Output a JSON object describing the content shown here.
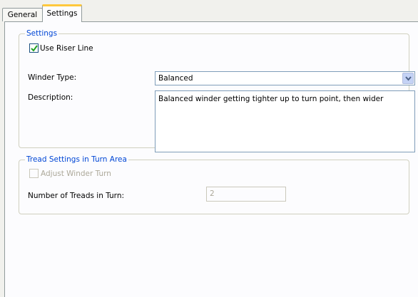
{
  "tabs": [
    {
      "label": "General",
      "active": false
    },
    {
      "label": "Settings",
      "active": true
    }
  ],
  "settings_group": {
    "legend": "Settings",
    "use_riser_line": {
      "label": "Use Riser Line",
      "checked": true
    },
    "winder_type": {
      "label": "Winder Type:",
      "value": "Balanced"
    },
    "description": {
      "label": "Description:",
      "value": "Balanced winder getting tighter up to turn point, then wider"
    }
  },
  "tread_group": {
    "legend": "Tread Settings in Turn Area",
    "adjust_winder_turn": {
      "label": "Adjust Winder Turn",
      "checked": false,
      "enabled": false
    },
    "number_of_treads": {
      "label": "Number of Treads in Turn:",
      "value": "2",
      "enabled": false
    }
  },
  "colors": {
    "accent_tab": "#ffc83c",
    "group_legend": "#0046d5",
    "disabled_text": "#aca899",
    "checkmark": "#21a121"
  }
}
